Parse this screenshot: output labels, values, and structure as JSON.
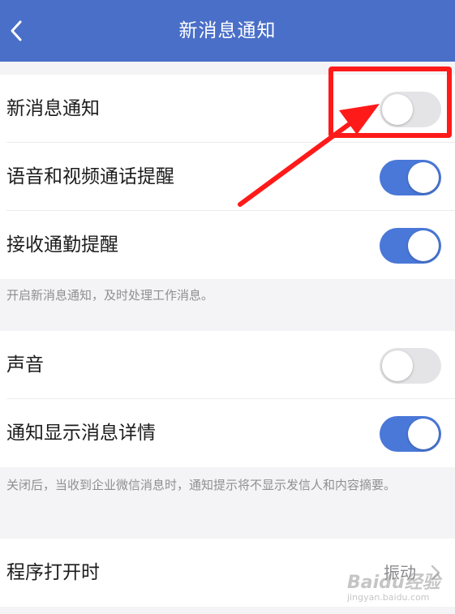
{
  "header": {
    "title": "新消息通知",
    "back_icon": "chevron-left-icon"
  },
  "section1": {
    "items": [
      {
        "label": "新消息通知",
        "state": "off"
      },
      {
        "label": "语音和视频通话提醒",
        "state": "on"
      },
      {
        "label": "接收通勤提醒",
        "state": "on"
      }
    ],
    "note": "开启新消息通知，及时处理工作消息。"
  },
  "section2": {
    "items": [
      {
        "label": "声音",
        "state": "off"
      },
      {
        "label": "通知显示消息详情",
        "state": "on"
      }
    ],
    "note": "关闭后，当收到企业微信消息时，通知提示将不显示发信人和内容摘要。"
  },
  "section3": {
    "item": {
      "label": "程序打开时",
      "value": "振动"
    }
  },
  "watermark": {
    "main": "Baidu经验",
    "sub": "jingyan.baidu.com"
  },
  "colors": {
    "header": "#4a6fc8",
    "toggle_on": "#4a78d8",
    "toggle_off": "#e4e4e6",
    "annotation": "#ff1a1a"
  }
}
